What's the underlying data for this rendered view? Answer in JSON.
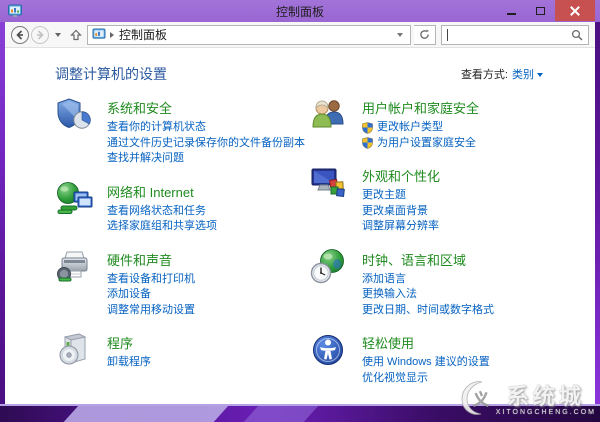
{
  "window": {
    "title": "控制面板"
  },
  "navbar": {
    "address_text": "控制面板",
    "search_value": ""
  },
  "header": {
    "title": "调整计算机的设置",
    "view_label": "查看方式:",
    "view_value": "类别"
  },
  "columns": {
    "left": [
      {
        "title": "系统和安全",
        "icon": "system-security-icon",
        "links": [
          {
            "text": "查看你的计算机状态"
          },
          {
            "text": "通过文件历史记录保存你的文件备份副本"
          },
          {
            "text": "查找并解决问题"
          }
        ]
      },
      {
        "title": "网络和 Internet",
        "icon": "network-internet-icon",
        "links": [
          {
            "text": "查看网络状态和任务"
          },
          {
            "text": "选择家庭组和共享选项"
          }
        ]
      },
      {
        "title": "硬件和声音",
        "icon": "hardware-sound-icon",
        "links": [
          {
            "text": "查看设备和打印机"
          },
          {
            "text": "添加设备"
          },
          {
            "text": "调整常用移动设置"
          }
        ]
      },
      {
        "title": "程序",
        "icon": "programs-icon",
        "links": [
          {
            "text": "卸载程序"
          }
        ]
      }
    ],
    "right": [
      {
        "title": "用户帐户和家庭安全",
        "icon": "user-accounts-icon",
        "links": [
          {
            "text": "更改帐户类型",
            "uac_shield": true
          },
          {
            "text": "为用户设置家庭安全",
            "uac_shield": true
          }
        ]
      },
      {
        "title": "外观和个性化",
        "icon": "appearance-icon",
        "links": [
          {
            "text": "更改主题"
          },
          {
            "text": "更改桌面背景"
          },
          {
            "text": "调整屏幕分辨率"
          }
        ]
      },
      {
        "title": "时钟、语言和区域",
        "icon": "clock-language-icon",
        "links": [
          {
            "text": "添加语言"
          },
          {
            "text": "更换输入法"
          },
          {
            "text": "更改日期、时间或数字格式"
          }
        ]
      },
      {
        "title": "轻松使用",
        "icon": "ease-of-access-icon",
        "links": [
          {
            "text": "使用 Windows 建议的设置"
          },
          {
            "text": "优化视觉显示"
          }
        ]
      }
    ]
  },
  "watermark": {
    "title": "系统城",
    "subtitle": "XITONGCHENG.COM"
  },
  "colors": {
    "titlebar": "#9a66d2",
    "close_button": "#c75050",
    "category_title": "#1f8b1f",
    "task_link": "#0662c1",
    "page_title": "#2b5aa0"
  }
}
